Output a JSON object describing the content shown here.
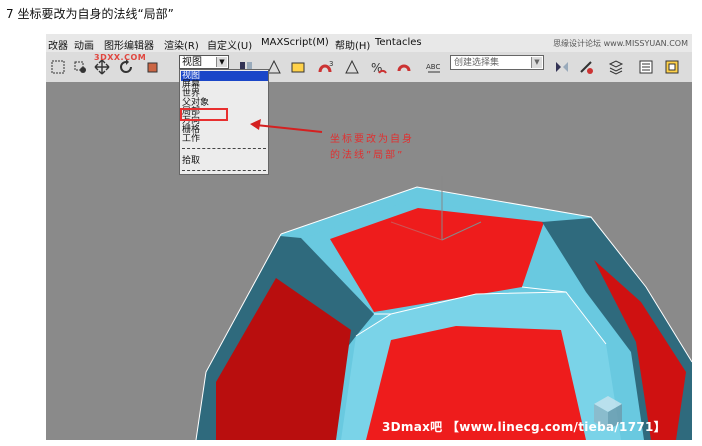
{
  "caption": "7 坐标要改为自身的法线“局部”",
  "menubar": {
    "items": [
      "改器",
      "动画",
      "图形编辑器",
      "渲染(R)",
      "自定义(U)",
      "MAXScript(M)",
      "帮助(H)",
      "Tentacles"
    ],
    "watermark": "思缘设计论坛 www.MISSYUAN.COM"
  },
  "toolbar": {
    "site_watermark": "3DXX.COM",
    "coord_system_value": "视图",
    "named_selection_placeholder": "创建选择集"
  },
  "coord_dropdown": {
    "items": [
      "视图",
      "屏幕",
      "世界",
      "父对象",
      "局部",
      "万向",
      "栅格",
      "工作",
      "拾取"
    ],
    "selected_index": 0,
    "highlighted_item": "局部"
  },
  "annotation": {
    "line1": "坐标要改为自身",
    "line2": "的法线”局部”"
  },
  "bottom_watermark": "3Dmax吧 【www.linecg.com/tieba/1771】",
  "colors": {
    "viewport_bg": "#8a8a8a",
    "face_red": "#ee1c1c",
    "bevel_cyan": "#69c9e0",
    "bevel_dark": "#2f6a7d",
    "annotation_red": "#e03030"
  }
}
